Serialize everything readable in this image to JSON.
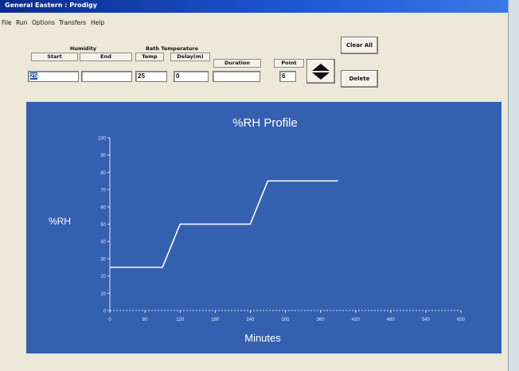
{
  "window": {
    "title": "General Eastern : Prodigy"
  },
  "menu": [
    "File",
    "Run",
    "Options",
    "Transfers",
    "Help"
  ],
  "headers": {
    "humidity": "Humidity",
    "bath_temperature": "Bath Temperature",
    "start": "Start",
    "end": "End",
    "temp": "Temp",
    "delay": "Delay(m)",
    "duration": "Duration",
    "point": "Point"
  },
  "fields": {
    "start": "25",
    "end": "",
    "temp": "25",
    "delay": "0",
    "duration": "",
    "point": "6"
  },
  "buttons": {
    "clear_all": "Clear All",
    "delete": "Delete"
  },
  "colors": {
    "plot_bg": "#3560b0",
    "line": "#ffffff",
    "titlebar": "#0a2a8e"
  },
  "chart_data": {
    "type": "line",
    "title": "%RH Profile",
    "xlabel": "Minutes",
    "ylabel": "%RH",
    "xlim": [
      0,
      600
    ],
    "ylim": [
      0,
      100
    ],
    "x_ticks": [
      0,
      60,
      120,
      180,
      240,
      300,
      360,
      420,
      480,
      540,
      600
    ],
    "y_ticks": [
      0,
      10,
      20,
      30,
      40,
      50,
      60,
      70,
      80,
      90,
      100
    ],
    "series": [
      {
        "x": [
          0,
          90,
          120,
          240,
          270,
          390
        ],
        "y": [
          25,
          25,
          50,
          50,
          75,
          75
        ]
      }
    ]
  }
}
